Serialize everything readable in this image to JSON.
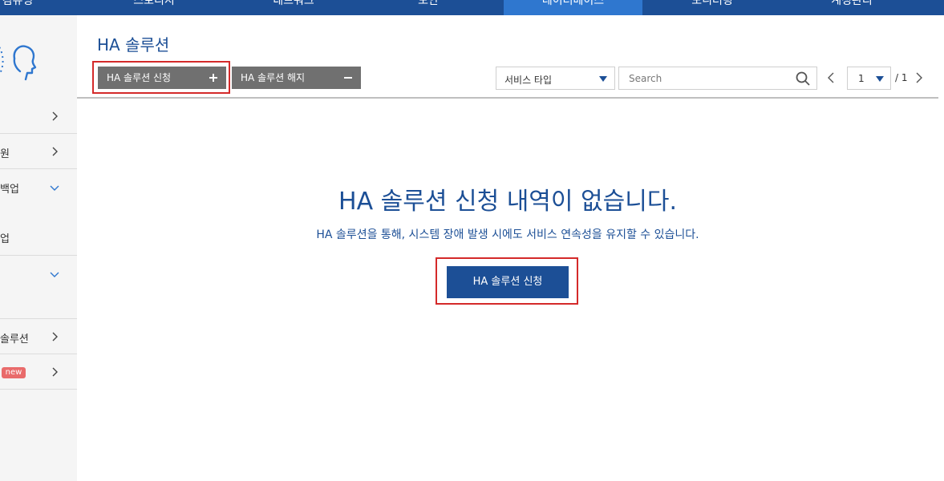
{
  "topnav": {
    "items": [
      "컴퓨팅",
      "스토리지",
      "네트워크",
      "보안",
      "데이터베이스",
      "모니터링",
      "계정관리"
    ],
    "active_index": 4
  },
  "sidebar": {
    "items": [
      {
        "label": "",
        "chevron": "chevron-right-icon"
      },
      {
        "label": "원",
        "chevron": "chevron-right-icon"
      },
      {
        "label": "백업",
        "chevron": "chevron-down-icon",
        "sub": "업"
      },
      {
        "label": "",
        "chevron": "chevron-down-icon"
      },
      {
        "label": "솔루션",
        "chevron": "chevron-right-icon"
      },
      {
        "label": "",
        "badge": "new",
        "chevron": "chevron-right-icon"
      }
    ]
  },
  "page": {
    "title": "HA 솔루션",
    "apply_button": "HA 솔루션 신청",
    "cancel_button": "HA 솔루션 해지"
  },
  "filters": {
    "service_type": "서비스 타입",
    "search_placeholder": "Search",
    "page_current": "1",
    "page_total": "/ 1"
  },
  "empty_state": {
    "title": "HA 솔루션 신청 내역이 없습니다.",
    "description": "HA 솔루션을 통해, 시스템 장애 발생 시에도 서비스 연속성을 유지할 수 있습니다.",
    "button": "HA 솔루션 신청"
  },
  "colors": {
    "primary": "#1c4f96",
    "nav_active": "#2f77cf",
    "gray_button": "#707070",
    "highlight": "#d42a2a",
    "badge": "#e96b6b"
  }
}
